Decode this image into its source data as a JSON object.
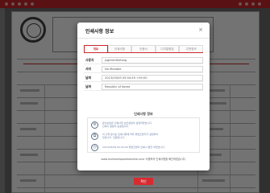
{
  "modal": {
    "title": "인쇄사항 정보",
    "close_symbol": "×",
    "tabs": [
      {
        "label": "개요",
        "active": true
      },
      {
        "label": "인쇄사항",
        "active": false
      },
      {
        "label": "인증서",
        "active": false
      },
      {
        "label": "디지털원본",
        "active": false
      },
      {
        "label": "주변정보",
        "active": false
      }
    ],
    "fields": [
      {
        "label": "사용자",
        "value": "jsgtmhdfuitong"
      },
      {
        "label": "서버",
        "value": "No Mutable"
      },
      {
        "label": "날짜",
        "value": "2013/03/09 05:04:49 +09:00"
      },
      {
        "label": "날짜",
        "value": "Republic of Korea"
      }
    ],
    "section_title": "인쇄사항 정보",
    "info": [
      {
        "icon": "security-settings-icon",
        "symbol": "⚙",
        "line1": "문서보호된 인쇄사항 보안설정이 설정되었습니다.",
        "line2": "인쇄시 원본이 보호됩니다."
      },
      {
        "icon": "document-copy-icon",
        "symbol": "⧉",
        "line1": "이 출력 문서는 인쇄사항에 따라 위변조방지가 설정되어",
        "line2": "있습니다. 진본입니다."
      },
      {
        "icon": "clock-icon",
        "symbol": "◷",
        "line1": "2013/03/09 05:04:49 위변조방지 인쇄시 발급 되었습니다.",
        "line2": ""
      }
    ],
    "footer_note": "www.mulmanhapstreamwire.co.kr 사용하여 인쇄사항을 확인하였습니다.",
    "confirm_label": "확인"
  },
  "colors": {
    "accent": "#c8262c",
    "confirm": "#d72a30",
    "info_text": "#6a7fa5"
  }
}
